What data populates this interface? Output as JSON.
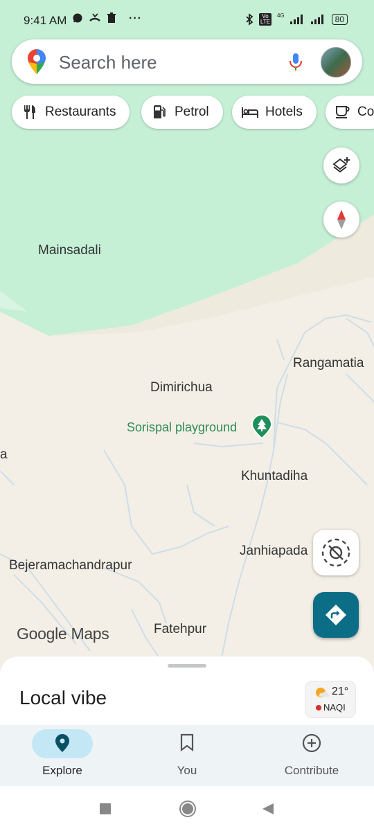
{
  "status_bar": {
    "time": "9:41 AM",
    "network_badge": "Vo LTE",
    "network_type": "4G",
    "battery": "80",
    "icons": [
      "whatsapp-icon",
      "missed-call-icon",
      "trash-icon",
      "more-dots-icon",
      "bluetooth-icon",
      "signal-icon",
      "battery-icon"
    ]
  },
  "search": {
    "placeholder": "Search here",
    "icons": [
      "maps-pin-logo",
      "mic-icon",
      "avatar"
    ]
  },
  "chips": [
    {
      "label": "Restaurants",
      "icon": "restaurant-icon"
    },
    {
      "label": "Petrol",
      "icon": "petrol-icon"
    },
    {
      "label": "Hotels",
      "icon": "hotel-icon"
    },
    {
      "label": "Co",
      "icon": "coffee-icon"
    }
  ],
  "map": {
    "labels": {
      "mainsadali": "Mainsadali",
      "rangamatia": "Rangamatia",
      "dimirichua": "Dimirichua",
      "poi": "Sorispal playground",
      "edge_a": "a",
      "khuntadiha": "Khuntadiha",
      "janhiapada": "Janhiapada",
      "bejeramachandrapur": "Bejeramachandrapur",
      "fatehpur": "Fatehpur"
    },
    "wordmark": "Google Maps",
    "colors": {
      "land": "#f3efe6",
      "green_area": "#c5f0d6",
      "road": "#cfdde8",
      "poi_green": "#2e8b57",
      "directions": "#0b6e86"
    }
  },
  "sheet": {
    "title": "Local vibe",
    "weather": {
      "temp": "21°",
      "aqi": "NAQI"
    }
  },
  "nav": {
    "items": [
      {
        "label": "Explore",
        "icon": "explore-pin-icon",
        "active": true
      },
      {
        "label": "You",
        "icon": "bookmark-icon",
        "active": false
      },
      {
        "label": "Contribute",
        "icon": "add-circle-icon",
        "active": false
      }
    ]
  }
}
